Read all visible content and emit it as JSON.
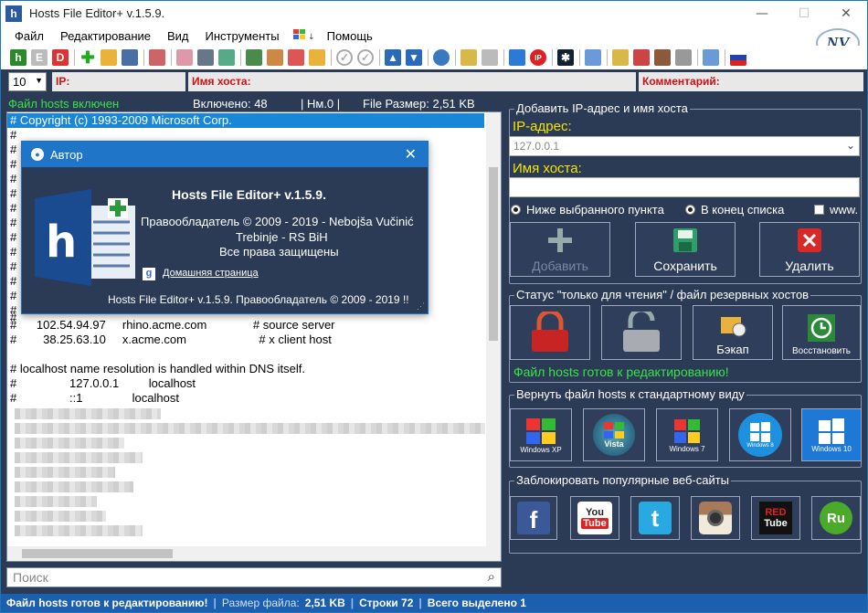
{
  "window": {
    "title": "Hosts File Editor+ v.1.5.9.",
    "minimize": "—",
    "maximize": "☐",
    "close": "✕"
  },
  "menu": [
    "Файл",
    "Редактирование",
    "Вид",
    "Инструменты",
    "Помощь"
  ],
  "logo_text": "NV",
  "toolbar": {
    "h": "h",
    "e": "E",
    "d": "D",
    "ip": "IP"
  },
  "address_bar": {
    "count_value": "10",
    "ip_label": "IP:",
    "host_label": "Имя хоста:",
    "comment_label": "Комментарий:"
  },
  "status_line": {
    "enabled": "Файл hosts включен",
    "enabled_count": "Включено: 48",
    "nm": "| Нм.0 |",
    "file_size": "File Размер: 2,51 KB"
  },
  "editor": {
    "lines": [
      "# Copyright (c) 1993-2009 Microsoft Corp.",
      "#",
      "#",
      "#",
      "#",
      "#",
      "#",
      "#",
      "#",
      "#",
      "#",
      "#",
      "#",
      "#",
      "#",
      "#      102.54.94.97     rhino.acme.com              # source server",
      "#        38.25.63.10     x.acme.com                      # x client host",
      "",
      "# localhost name resolution is handled within DNS itself.",
      "#                127.0.0.1         localhost",
      "#                ::1               localhost"
    ]
  },
  "search": {
    "placeholder": "Поиск"
  },
  "bottom_status": {
    "ready": "Файл hosts готов к редактированию!",
    "size_label": "Размер файла:",
    "size_value": "2,51 KB",
    "rows": "Строки 72",
    "selected": "Всего выделено 1"
  },
  "add_group": {
    "title": "Добавить IP-адрес и имя хоста",
    "ip_label": "IP-адрес:",
    "ip_placeholder": "127.0.0.1",
    "host_label": "Имя хоста:",
    "radio_below": "Ниже выбранного пункта",
    "radio_end": "В конец списка",
    "www": "www.",
    "add_button": "Добавить",
    "save_button": "Сохранить",
    "delete_button": "Удалить"
  },
  "readonly_group": {
    "title": "Статус \"только для чтения\" / файл резервных хостов",
    "backup_button": "Бэкап",
    "restore_button": "Восстановить",
    "ready_text": "Файл hosts готов к редактированию!"
  },
  "restore_group": {
    "title": "Вернуть файл hosts к стандартному виду",
    "os": [
      {
        "label": "Windows XP"
      },
      {
        "label": "Vista"
      },
      {
        "label": "Windows 7"
      },
      {
        "label": "Windows 8"
      },
      {
        "label": "Windows 10"
      }
    ]
  },
  "block_group": {
    "title": "Заблокировать популярные веб-сайты",
    "sites": [
      {
        "glyph": "f",
        "bg": "#3b5998"
      },
      {
        "glyph": "You\nTube",
        "bg": "#ffffff"
      },
      {
        "glyph": "t",
        "bg": "#29a9e1"
      },
      {
        "glyph": "◉",
        "bg": "#8a5a3a"
      },
      {
        "glyph": "RED\nTube",
        "bg": "#111111"
      },
      {
        "glyph": "Ru",
        "bg": "#4caa2a"
      }
    ]
  },
  "about_dialog": {
    "title": "Автор",
    "app_name": "Hosts File Editor+ v.1.5.9.",
    "copyright": "Правообладатель © 2009 - 2019 - Nebojša Vučinić",
    "location": "Trebinje - RS BiH",
    "rights": "Все права защищены",
    "homepage": "Домашняя страница",
    "footer": "Hosts File Editor+  v.1.5.9.   Правообладатель © 2009 - 2019  !!"
  },
  "colors": {
    "panel_bg": "#2b3a55",
    "accent_blue": "#1f76c8",
    "ready_green": "#3ae24a",
    "label_yellow": "#f5e400",
    "address_red": "#d01010"
  }
}
